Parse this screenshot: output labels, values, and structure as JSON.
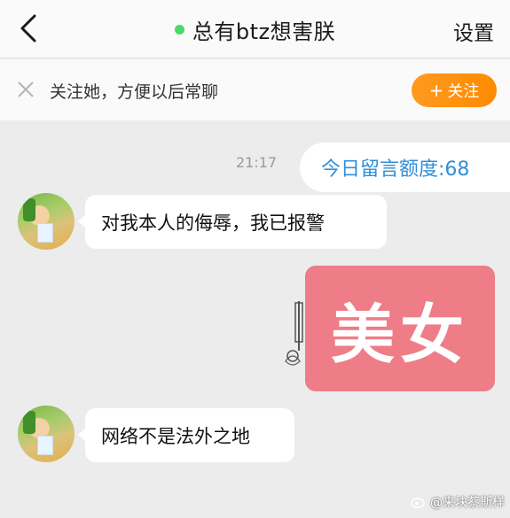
{
  "header": {
    "title": "总有btz想害朕",
    "settings_label": "设置",
    "online_color": "#4cd964"
  },
  "follow_bar": {
    "prompt": "关注她，方便以后常聊",
    "button_plus": "+",
    "button_label": "关注",
    "button_color": "#ff8a00"
  },
  "chat": {
    "timestamp": "21:17",
    "quota_text": "今日留言额度:68",
    "messages": [
      {
        "side": "left",
        "type": "text",
        "text": "对我本人的侮辱，我已报警"
      },
      {
        "side": "right",
        "type": "sticker",
        "text": "美女"
      },
      {
        "side": "left",
        "type": "text",
        "text": "网络不是法外之地"
      }
    ]
  },
  "watermark": {
    "text": "@来块蔡斯样"
  },
  "icons": {
    "back": "chevron-left-icon",
    "close": "close-icon",
    "weibo": "weibo-logo-icon"
  }
}
